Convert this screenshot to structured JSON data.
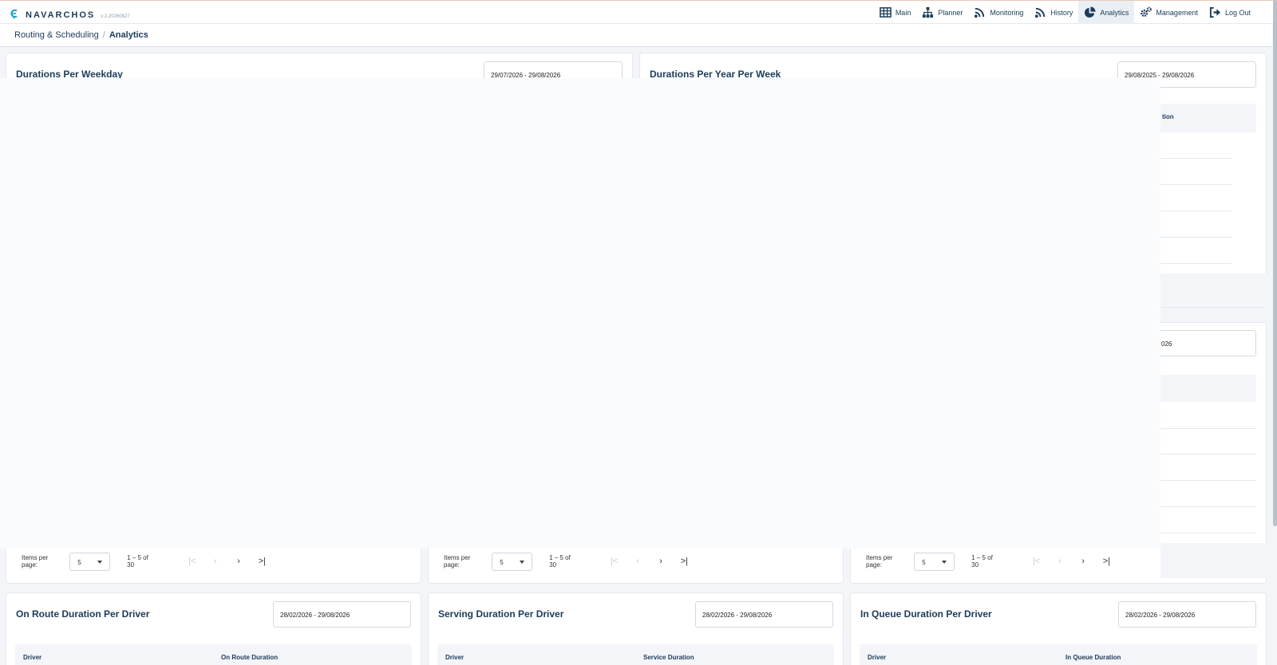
{
  "app": {
    "name": "NAVARCHOS",
    "version": "v 2.20260827"
  },
  "nav": [
    {
      "label": "Main",
      "icon": "table-grid-icon",
      "active": false
    },
    {
      "label": "Planner",
      "icon": "sitemap-icon",
      "active": false
    },
    {
      "label": "Monitoring",
      "icon": "signal-waves-icon",
      "active": false
    },
    {
      "label": "History",
      "icon": "signal-waves-icon",
      "active": false
    },
    {
      "label": "Analytics",
      "icon": "pie-chart-icon",
      "active": true
    },
    {
      "label": "Management",
      "icon": "gears-icon",
      "active": false
    },
    {
      "label": "Log Out",
      "icon": "logout-icon",
      "active": false
    }
  ],
  "breadcrumb": {
    "parent": "Routing & Scheduling",
    "separator": "/",
    "current": "Analytics"
  },
  "cards": {
    "weekday": {
      "title": "Durations Per Weekday",
      "date_range": "29/07/2026 - 29/08/2026"
    },
    "year_week": {
      "title": "Durations Per Year Per Week",
      "date_range": "29/08/2025 - 29/08/2026",
      "peek_header": "tion"
    },
    "mid_right": {
      "date_peek": "026"
    },
    "on_route": {
      "title": "On Route Duration Per Driver",
      "date_range": "28/02/2026 - 29/08/2026",
      "col_driver": "Driver",
      "col_value": "On Route Duration"
    },
    "serving": {
      "title": "Serving Duration Per Driver",
      "date_range": "28/02/2026 - 29/08/2026",
      "col_driver": "Driver",
      "col_value": "Service Duration"
    },
    "in_queue": {
      "title": "In Queue Duration Per Driver",
      "date_range": "28/02/2026 - 29/08/2026",
      "col_driver": "Driver",
      "col_value": "In Queue Duration"
    }
  },
  "paginator": {
    "items_per_page_label": "Items per page:",
    "page_size": "5",
    "range_label": "1 – 5 of 30",
    "first_glyph": "|<",
    "prev_glyph": "‹",
    "next_glyph": "›",
    "last_glyph": ">|"
  },
  "colors": {
    "brand": "#1b3b5a",
    "accent": "#1fa3c7",
    "active_nav_bg": "#e9eff5",
    "page_bg": "#f3f5f8"
  }
}
